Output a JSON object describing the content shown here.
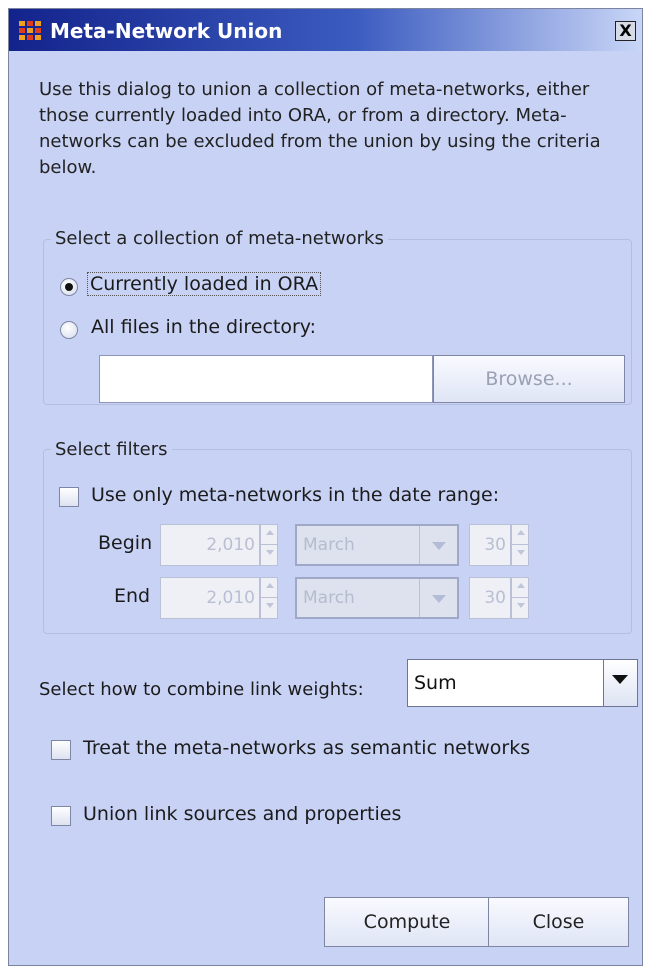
{
  "window": {
    "title": "Meta-Network Union",
    "close_symbol": "X"
  },
  "description": "Use this dialog to union a collection of meta-networks, either those currently loaded into ORA, or from a directory. Meta-networks can be excluded from the union by using the criteria below.",
  "collection": {
    "title": "Select a collection of meta-networks",
    "option_loaded": "Currently loaded in ORA",
    "option_directory": "All files in the directory:",
    "selected": "Currently loaded in ORA",
    "directory_value": "",
    "browse_label": "Browse..."
  },
  "filters": {
    "title": "Select filters",
    "date_range_label": "Use only meta-networks in the date range:",
    "date_range_checked": false,
    "begin": {
      "label": "Begin",
      "year": "2,010",
      "month": "March",
      "day": "30"
    },
    "end": {
      "label": "End",
      "year": "2,010",
      "month": "March",
      "day": "30"
    }
  },
  "combine": {
    "label": "Select how to combine link weights:",
    "value": "Sum"
  },
  "options": {
    "semantic_label": "Treat the meta-networks as semantic networks",
    "semantic_checked": false,
    "union_sources_label": "Union link sources and properties",
    "union_sources_checked": false
  },
  "buttons": {
    "compute": "Compute",
    "close": "Close"
  },
  "colors": {
    "dialog_bg": "#c8d2f5",
    "titlebar_start": "#13238c",
    "titlebar_end": "#c9d6f7",
    "app_icon_orange": "#f0a020"
  },
  "icons": {
    "app": "ora-grid-icon",
    "close": "close-icon"
  }
}
